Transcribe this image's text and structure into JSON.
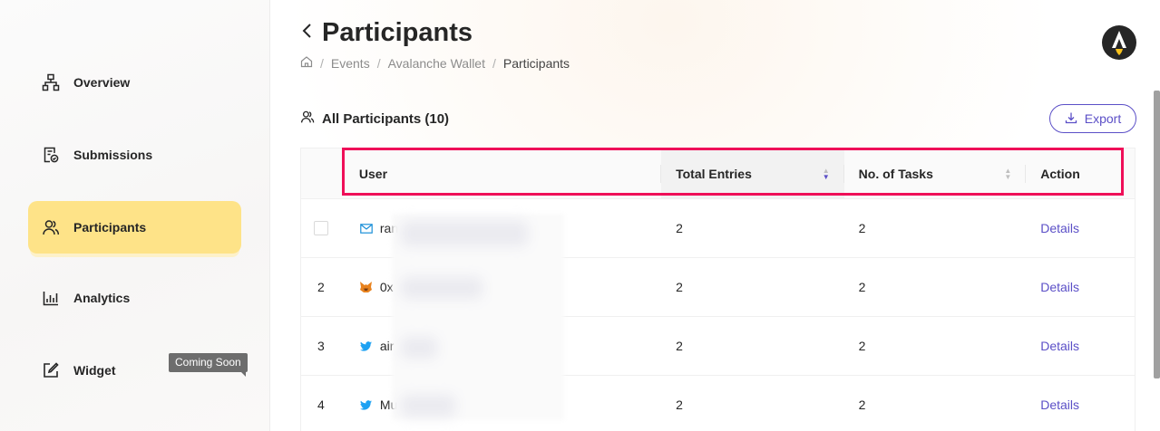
{
  "sidebar": {
    "items": [
      {
        "label": "Overview",
        "icon": "sitemap-icon"
      },
      {
        "label": "Submissions",
        "icon": "document-check-icon"
      },
      {
        "label": "Participants",
        "icon": "users-icon",
        "active": true
      },
      {
        "label": "Analytics",
        "icon": "bar-chart-icon"
      },
      {
        "label": "Widget",
        "icon": "edit-icon"
      }
    ],
    "badge": "Coming Soon"
  },
  "header": {
    "title": "Participants",
    "breadcrumb": [
      "Events",
      "Avalanche Wallet",
      "Participants"
    ]
  },
  "section": {
    "title": "All Participants (10)",
    "export_label": "Export"
  },
  "table": {
    "columns": [
      "User",
      "Total Entries",
      "No. of Tasks",
      "Action"
    ],
    "rows": [
      {
        "index": "",
        "user_type": "email-icon",
        "user": "ran",
        "total_entries": "2",
        "tasks": "2",
        "action": "Details"
      },
      {
        "index": "2",
        "user_type": "metamask-icon",
        "user": "0x",
        "total_entries": "2",
        "tasks": "2",
        "action": "Details"
      },
      {
        "index": "3",
        "user_type": "twitter-icon",
        "user": "air",
        "total_entries": "2",
        "tasks": "2",
        "action": "Details"
      },
      {
        "index": "4",
        "user_type": "twitter-icon",
        "user": "Mu",
        "total_entries": "2",
        "tasks": "2",
        "action": "Details"
      }
    ]
  },
  "colors": {
    "accent": "#5b4fc7",
    "active_nav": "#fee388",
    "highlight": "#ef0f58",
    "twitter": "#1da1f2"
  }
}
